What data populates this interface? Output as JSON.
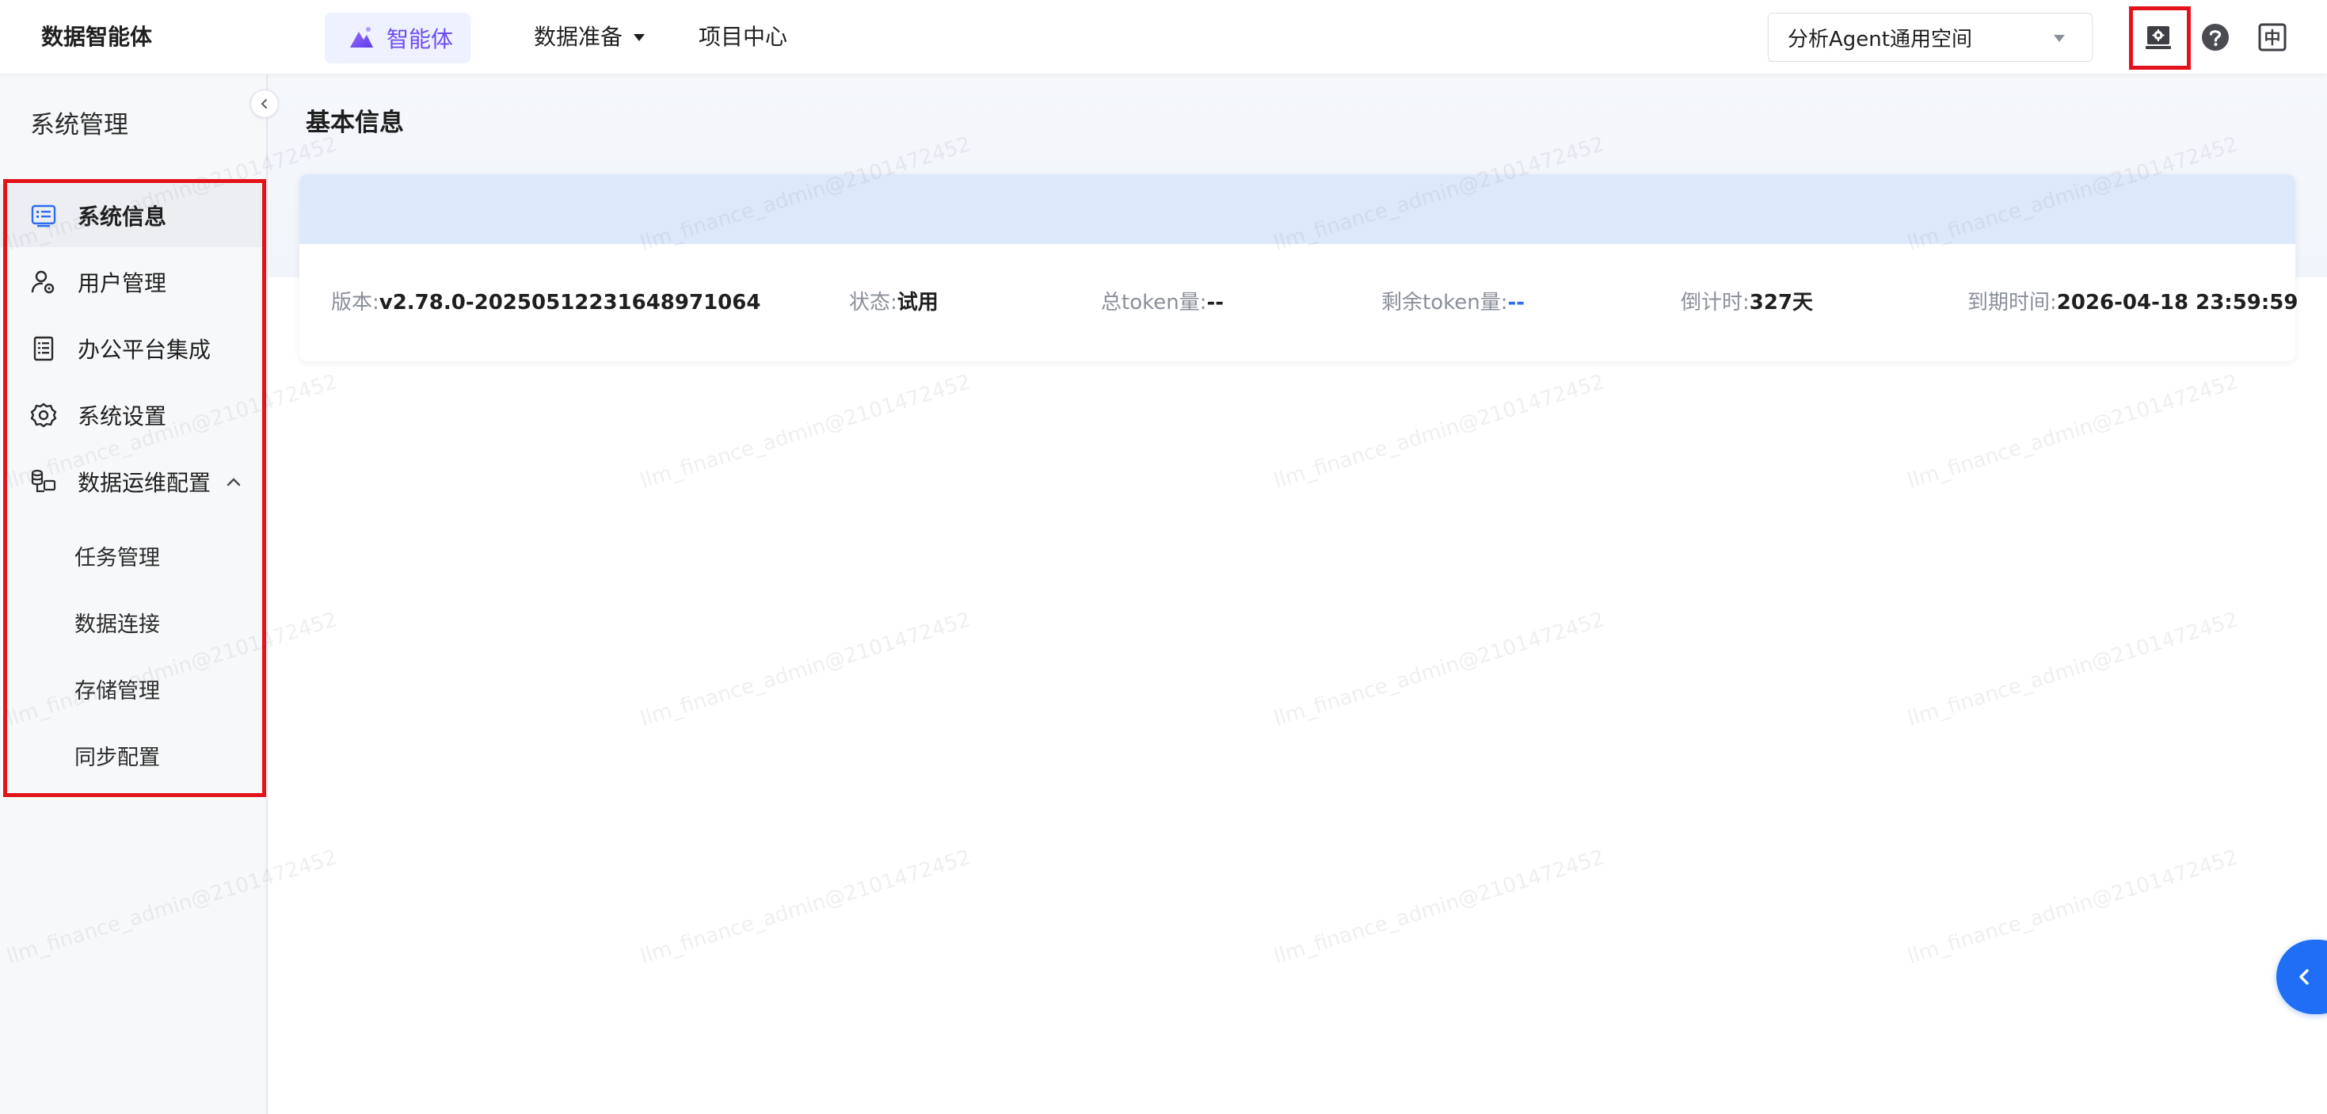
{
  "app": {
    "brand": "数据智能体"
  },
  "topnav": {
    "items": [
      {
        "label": "智能体",
        "active": true
      },
      {
        "label": "数据准备",
        "has_dropdown": true
      },
      {
        "label": "项目中心"
      }
    ],
    "workspace": {
      "selected": "分析Agent通用空间"
    },
    "icons": [
      "admin-settings-icon",
      "help-icon",
      "language-icon"
    ],
    "language_glyph": "中"
  },
  "sidebar": {
    "title": "系统管理",
    "items": [
      {
        "label": "系统信息",
        "icon": "system-info-icon",
        "active": true
      },
      {
        "label": "用户管理",
        "icon": "user-manage-icon"
      },
      {
        "label": "办公平台集成",
        "icon": "office-integration-icon"
      },
      {
        "label": "系统设置",
        "icon": "gear-icon"
      },
      {
        "label": "数据运维配置",
        "icon": "data-ops-icon",
        "expanded": true
      }
    ],
    "subitems": [
      {
        "label": "任务管理"
      },
      {
        "label": "数据连接"
      },
      {
        "label": "存储管理"
      },
      {
        "label": "同步配置"
      }
    ]
  },
  "main": {
    "title": "基本信息",
    "info": {
      "version_label": "版本:",
      "version_value": "v2.78.0-20250512231648971064",
      "status_label": "状态:",
      "status_value": "试用",
      "total_token_label": "总token量:",
      "total_token_value": "--",
      "remaining_token_label": "剩余token量:",
      "remaining_token_value": "--",
      "countdown_label": "倒计时:",
      "countdown_value": "327天",
      "expire_label": "到期时间:",
      "expire_value": "2026-04-18 23:59:59"
    }
  },
  "watermark": "llm_finance_admin@2101472452",
  "colors": {
    "accent_purple": "#6d4cf2",
    "accent_blue": "#1f6ef5",
    "highlight_red": "#e3131b",
    "card_header": "#dde9fb"
  }
}
